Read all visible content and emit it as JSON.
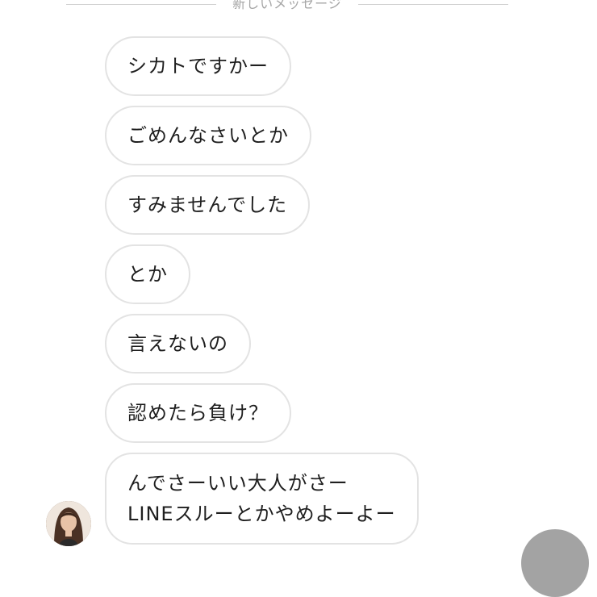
{
  "divider": {
    "label": "新しいメッセージ"
  },
  "messages": [
    {
      "text": "シカトですかー"
    },
    {
      "text": "ごめんなさいとか"
    },
    {
      "text": "すみませんでした"
    },
    {
      "text": "とか"
    },
    {
      "text": "言えないの"
    },
    {
      "text": "認めたら負け？"
    },
    {
      "lines": [
        "んでさーいい大人がさー",
        "LINEスルーとかやめよーよー"
      ]
    }
  ]
}
